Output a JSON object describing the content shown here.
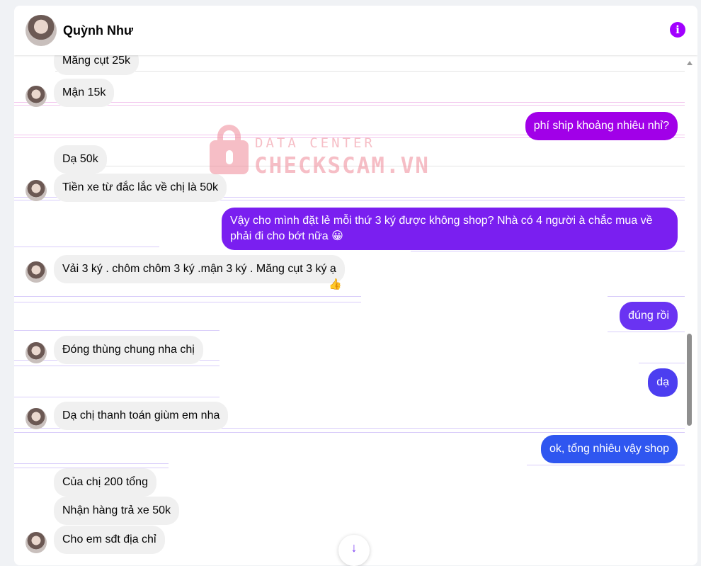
{
  "header": {
    "name": "Quỳnh Như",
    "info_icon": "info-icon",
    "info_glyph": "i",
    "accent": "#a100ff"
  },
  "watermark": {
    "line1": "DATA CENTER",
    "line2": "CHECKSCAM.VN"
  },
  "messages": [
    {
      "dir": "in",
      "text": "Măng cụt 25k"
    },
    {
      "dir": "in",
      "text": "Mận 15k"
    },
    {
      "dir": "out",
      "text": "phí ship khoảng nhiêu nhỉ?",
      "color": "#a100e8"
    },
    {
      "dir": "in",
      "text": "Dạ 50k"
    },
    {
      "dir": "in",
      "text": "Tiền xe từ đắc lắc về chị là 50k"
    },
    {
      "dir": "out",
      "text": "Vậy cho mình đặt lẻ mỗi thứ 3 ký được không shop? Nhà có 4 người à chắc mua về",
      "text2": "phải đi cho bớt nữa",
      "emoji": "😀",
      "color": "#7a1ff0"
    },
    {
      "dir": "in",
      "text": "Vải 3 ký . chôm chôm 3 ký .mận 3 ký . Măng cụt 3 ký ạ",
      "reaction": "👍"
    },
    {
      "dir": "out",
      "text": "đúng rồi",
      "color": "#6a33f2"
    },
    {
      "dir": "in",
      "text": "Đóng thùng chung nha chị"
    },
    {
      "dir": "out",
      "text": "dạ",
      "color": "#4c3ef0"
    },
    {
      "dir": "in",
      "text": "Dạ chị thanh toán giùm em nha"
    },
    {
      "dir": "out",
      "text": "ok, tổng nhiêu vậy shop",
      "color": "#2f56f0"
    },
    {
      "dir": "in",
      "text": "Của chị 200 tổng"
    },
    {
      "dir": "in",
      "text": "Nhận hàng trả xe 50k"
    },
    {
      "dir": "in",
      "text": "Cho em sđt địa chỉ"
    }
  ],
  "jump_icon": "arrow-down-icon",
  "jump_glyph": "↓"
}
